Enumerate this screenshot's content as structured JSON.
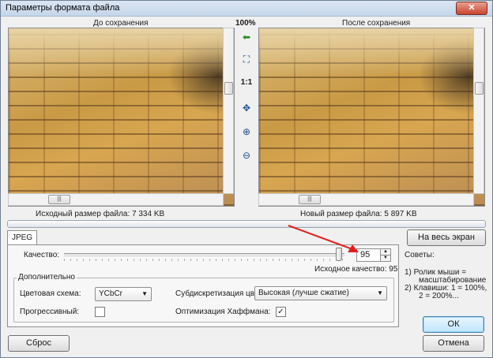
{
  "window": {
    "title": "Параметры формата файла",
    "close": "✕"
  },
  "preview": {
    "before_label": "До сохранения",
    "after_label": "После сохранения",
    "zoom": "100%",
    "tools": {
      "one_to_one": "1:1"
    },
    "original_size": "Исходный размер файла:  7 334 KB",
    "new_size": "Новый размер файла:  5 897 KB"
  },
  "tab": {
    "label": "JPEG"
  },
  "quality": {
    "label": "Качество:",
    "value": "95",
    "original": "Исходное качество: 95"
  },
  "advanced": {
    "label": "Дополнительно",
    "color_scheme_label": "Цветовая схема:",
    "color_scheme_value": "YCbCr",
    "progressive_label": "Прогрессивный:",
    "subsampling_label": "Субдискретизация цвета:",
    "subsampling_value": "Высокая (лучше сжатие)",
    "huffman_label": "Оптимизация Хаффмана:",
    "huffman_checked": "✓"
  },
  "buttons": {
    "fullscreen": "На весь экран",
    "ok": "ОК",
    "reset": "Сброс",
    "cancel": "Отмена"
  },
  "tips": {
    "title": "Советы:",
    "lines": [
      "1) Ролик мыши =",
      "масштабирование",
      "2) Клавиши: 1 = 100%,",
      "2 = 200%..."
    ]
  },
  "colors": {
    "accent_arrow": "#e02020",
    "ok_border": "#3c7fb1"
  }
}
